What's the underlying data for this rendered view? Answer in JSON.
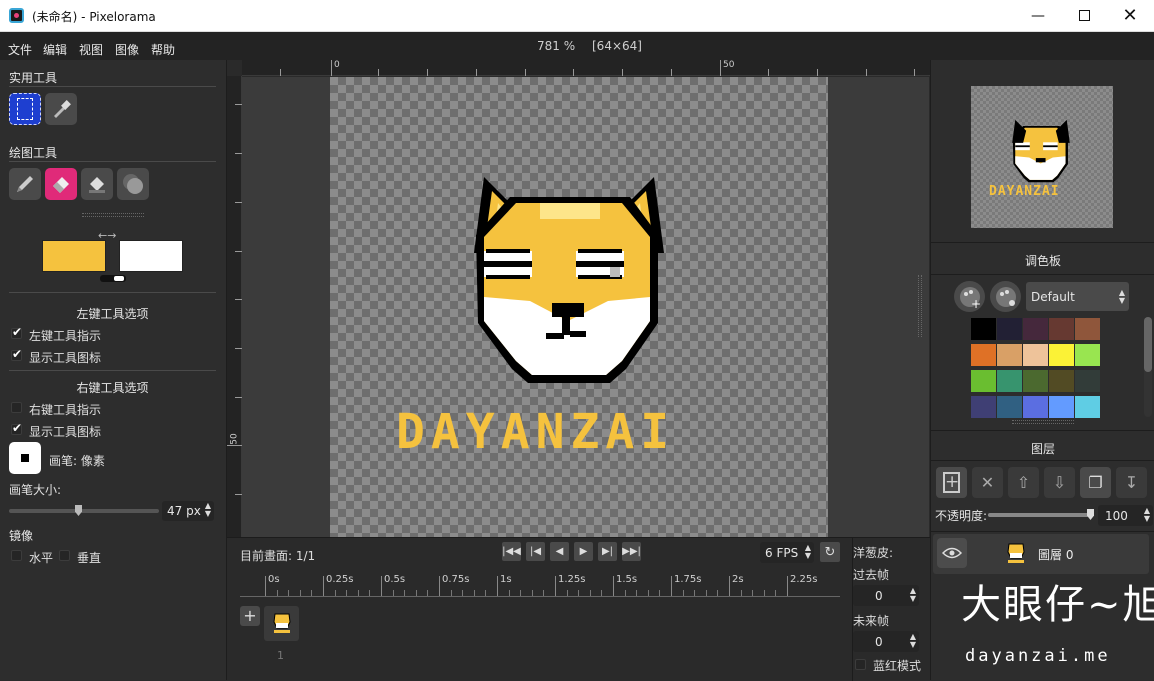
{
  "window": {
    "title": "(未命名) - Pixelorama"
  },
  "menubar": {
    "items": [
      "文件",
      "编辑",
      "视图",
      "图像",
      "帮助"
    ],
    "zoom": "781 %",
    "canvas_size": "[64×64]"
  },
  "left_panel": {
    "utility_tools_title": "实用工具",
    "drawing_tools_title": "绘图工具",
    "left_color": "#f5c23e",
    "right_color": "#ffffff",
    "left_options_title": "左键工具选项",
    "left_indicator_label": "左键工具指示",
    "left_show_icon_label": "显示工具图标",
    "right_options_title": "右键工具选项",
    "right_indicator_label": "右键工具指示",
    "right_show_icon_label": "显示工具图标",
    "brush_label": "画笔: 像素",
    "brush_size_label": "画笔大小:",
    "brush_size_value": "47 px",
    "mirror_title": "镜像",
    "horizontal_label": "水平",
    "vertical_label": "垂直"
  },
  "rulers": {
    "h_labels": [
      "0",
      "50"
    ],
    "v_labels": [
      "50"
    ]
  },
  "canvas": {
    "logo_text": "DAYANZAI"
  },
  "timeline": {
    "current_frame_label": "目前畫面: 1/1",
    "fps": "6 FPS",
    "ticks": [
      "0s",
      "0.25s",
      "0.5s",
      "0.75s",
      "1s",
      "1.25s",
      "1.5s",
      "1.75s",
      "2s",
      "2.25s"
    ],
    "frame_number": "1",
    "onion_title": "洋葱皮:",
    "past_frames_label": "过去帧",
    "past_frames_value": "0",
    "future_frames_label": "未来帧",
    "future_frames_value": "0",
    "blue_red_label": "蓝红模式"
  },
  "right_panel": {
    "preview_text": "DAYANZAI",
    "palette_title": "调色板",
    "palette_name": "Default",
    "palette_colors": [
      "#000000",
      "#222034",
      "#45283c",
      "#663931",
      "#8f563b",
      "#df7126",
      "#d9a066",
      "#eec39a",
      "#fbf236",
      "#99e550",
      "#6abe30",
      "#37946e",
      "#4b692f",
      "#524b24",
      "#323c39",
      "#3f3f74",
      "#306082",
      "#5b6ee1",
      "#639bff",
      "#5fcde4"
    ],
    "layers_title": "图层",
    "opacity_label": "不透明度:",
    "opacity_value": "100",
    "opacity_level": 1.0,
    "layer_name": "圖層 0"
  },
  "watermark": {
    "text": "大眼仔~旭",
    "url": "dayanzai.me"
  }
}
